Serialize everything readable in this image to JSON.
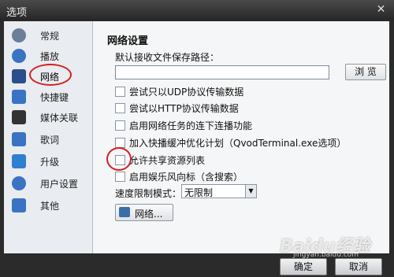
{
  "window": {
    "title": "选项",
    "close": "✕"
  },
  "sidebar": {
    "items": [
      {
        "label": "常规",
        "icon": "gear-icon",
        "color": "#6b7f98"
      },
      {
        "label": "播放",
        "icon": "play-icon",
        "color": "#3a73c4"
      },
      {
        "label": "网络",
        "icon": "network-icon",
        "color": "#2b4f8a",
        "active": true
      },
      {
        "label": "快捷键",
        "icon": "shortcut-icon",
        "color": "#3a73c4"
      },
      {
        "label": "媒体关联",
        "icon": "film-icon",
        "color": "#333333"
      },
      {
        "label": "歌词",
        "icon": "lyrics-icon",
        "color": "#3a73c4"
      },
      {
        "label": "升级",
        "icon": "upgrade-icon",
        "color": "#2f7fd0"
      },
      {
        "label": "用户设置",
        "icon": "user-icon",
        "color": "#3a73c4"
      },
      {
        "label": "其他",
        "icon": "other-icon",
        "color": "#3a73c4"
      }
    ]
  },
  "network": {
    "heading": "网络设置",
    "path_label": "默认接收文件保存路径：",
    "path_value": "",
    "browse_label": "浏 览",
    "options": [
      {
        "label": "尝试只以UDP协议传输数据",
        "checked": false
      },
      {
        "label": "尝试以HTTP协议传输数据",
        "checked": false
      },
      {
        "label": "启用网络任务的连下连播功能",
        "checked": false
      },
      {
        "label": "加入快播缓冲优化计划（QvodTerminal.exe选项）",
        "checked": false
      },
      {
        "label": "允许共享资源列表",
        "checked": false
      },
      {
        "label": "启用娱乐风向标（含搜索）",
        "checked": false
      }
    ],
    "speed_label": "速度限制模式：",
    "speed_value": "无限制",
    "network_button": "网络..."
  },
  "buttons": {
    "ok": "确定",
    "cancel": "取消"
  },
  "watermark": {
    "brand": "Baidu经验",
    "url": "jingyan.baidu.com"
  }
}
